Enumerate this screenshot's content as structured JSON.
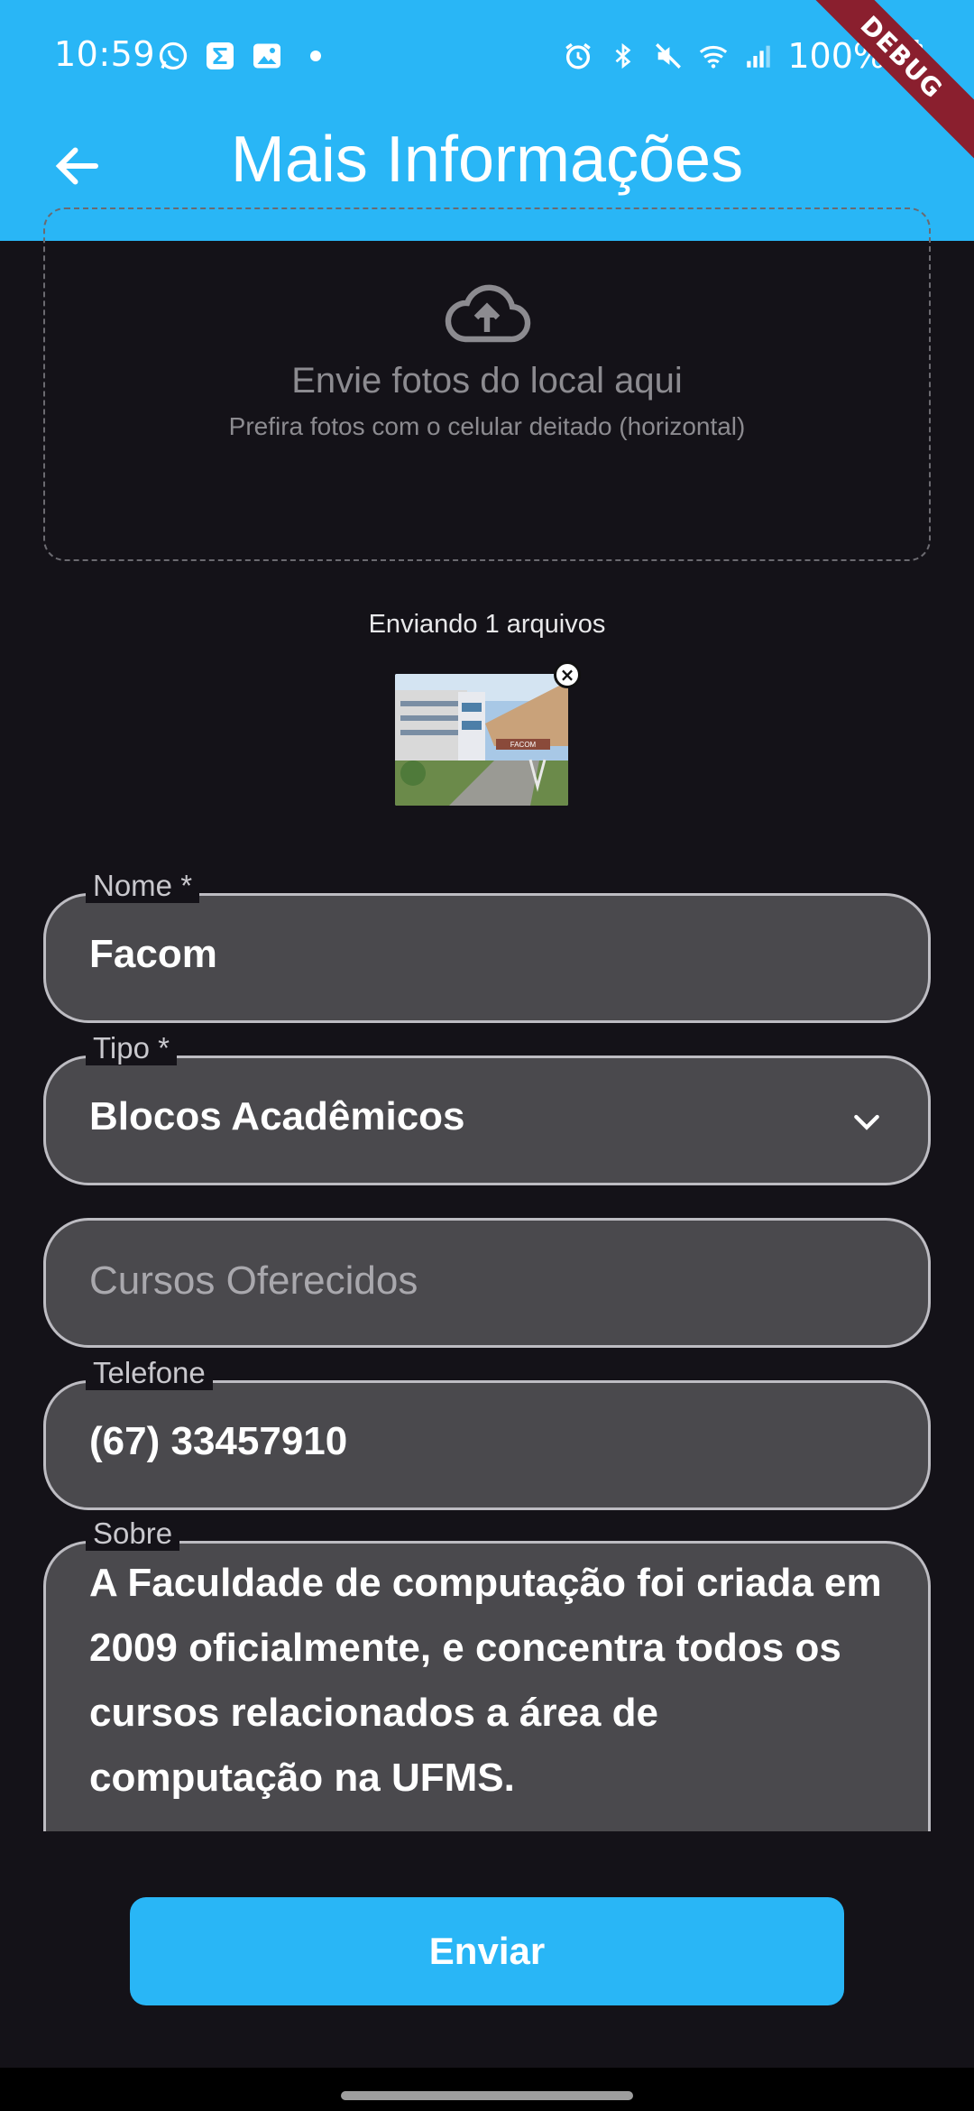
{
  "status_bar": {
    "time": "10:59",
    "battery": "100%",
    "debug_banner": "DEBUG"
  },
  "app_bar": {
    "title": "Mais Informações",
    "back_icon": "arrow-left-icon"
  },
  "upload": {
    "title": "Envie fotos do local aqui",
    "subtitle": "Prefira fotos com o celular deitado (horizontal)",
    "icon": "cloud-upload-icon"
  },
  "sending_status": "Enviando 1 arquivos",
  "form": {
    "nome": {
      "label": "Nome *",
      "value": "Facom"
    },
    "tipo": {
      "label": "Tipo *",
      "value": "Blocos Acadêmicos"
    },
    "cursos": {
      "placeholder": "Cursos Oferecidos"
    },
    "telefone": {
      "label": "Telefone",
      "value": "(67) 33457910"
    },
    "sobre": {
      "label": "Sobre",
      "value": "A Faculdade de computação foi criada em 2009 oficialmente, e concentra todos os cursos relacionados a área de computação na UFMS."
    }
  },
  "submit_label": "Enviar",
  "colors": {
    "primary": "#29b6f6",
    "background": "#141218",
    "field_fill": "#4a494d",
    "debug": "#8a1f2e"
  }
}
